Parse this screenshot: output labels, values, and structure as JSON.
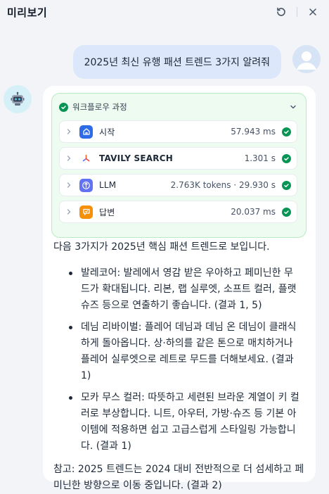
{
  "header": {
    "title": "미리보기",
    "refresh_icon": "refresh-icon",
    "close_icon": "close-icon"
  },
  "user_message": {
    "text": "2025년 최신 유행 패션 트렌드 3가지 알려줘"
  },
  "workflow": {
    "title": "워크플로우 과정",
    "status_color": "#079455",
    "nodes": [
      {
        "name": "시작",
        "meta": "57.943 ms",
        "icon": "home-icon",
        "icon_bg": "#2e6be6"
      },
      {
        "name": "TAVILY SEARCH",
        "meta": "1.301 s",
        "icon": "tavily-icon",
        "icon_bg": "#ffffff"
      },
      {
        "name": "LLM",
        "meta": "2.763K tokens · 29.930 s",
        "icon": "llm-icon",
        "icon_bg": "#6172f3"
      },
      {
        "name": "답변",
        "meta": "20.037 ms",
        "icon": "answer-icon",
        "icon_bg": "#f79009"
      }
    ]
  },
  "answer": {
    "intro": "다음 3가지가 2025년 핵심 패션 트렌드로 보입니다.",
    "bullets": [
      "발레코어: 발레에서 영감 받은 우아하고 페미닌한 무드가 확대됩니다. 리본, 랩 실루엣, 소프트 컬러, 플랫 슈즈 등으로 연출하기 좋습니다. (결과 1, 5)",
      "데님 리바이벌: 플레어 데님과 데님 온 데님이 클래식하게 돌아옵니다. 상·하의를 같은 톤으로 매치하거나 플레어 실루엣으로 레트로 무드를 더해보세요. (결과 1)",
      "모카 무스 컬러: 따뜻하고 세련된 브라운 계열이 키 컬러로 부상합니다. 니트, 아우터, 가방·슈즈 등 기본 아이템에 적용하면 쉽고 고급스럽게 스타일링 가능합니다. (결과 1)"
    ],
    "note": "참고: 2025 트렌드는 2024 대비 전반적으로 더 섬세하고 페미닌한 방향으로 이동 중입니다. (결과 2)"
  }
}
